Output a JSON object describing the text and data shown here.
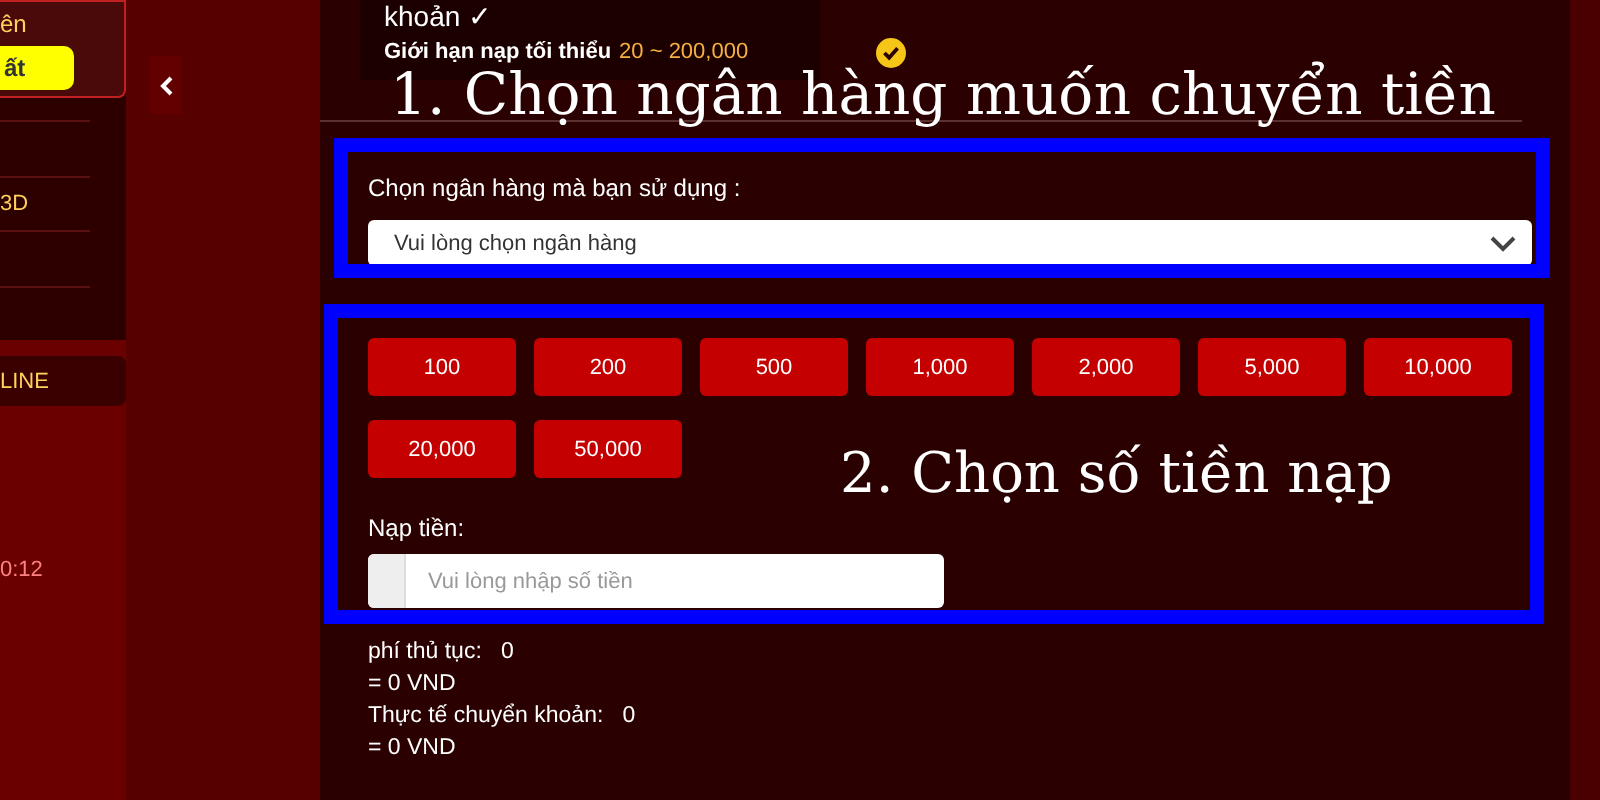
{
  "sidebar": {
    "card_text": "ên",
    "card_button": "ất",
    "items": [
      "3D"
    ],
    "online_label": "LINE",
    "time": "0:12"
  },
  "notice": {
    "title": "khoản ✓",
    "limit_label": "Giới hạn nạp tối thiểu",
    "limit_value": "20 ~ 200,000"
  },
  "bank": {
    "label": "Chọn ngân hàng mà bạn sử dụng :",
    "placeholder": "Vui lòng chọn ngân hàng"
  },
  "amounts": [
    "100",
    "200",
    "500",
    "1,000",
    "2,000",
    "5,000",
    "10,000",
    "20,000",
    "50,000"
  ],
  "deposit": {
    "label": "Nạp tiền:",
    "placeholder": "Vui lòng nhập số tiền"
  },
  "summary": [
    {
      "label": "phí thủ tục:",
      "value": "0",
      "total": "= 0 VND"
    },
    {
      "label": "Thực tế chuyển khoản:",
      "value": "0",
      "total": "= 0 VND"
    }
  ],
  "annotations": [
    "1. Chọn ngân hàng muốn chuyển tiền",
    "2. Chọn số tiền nạp"
  ]
}
